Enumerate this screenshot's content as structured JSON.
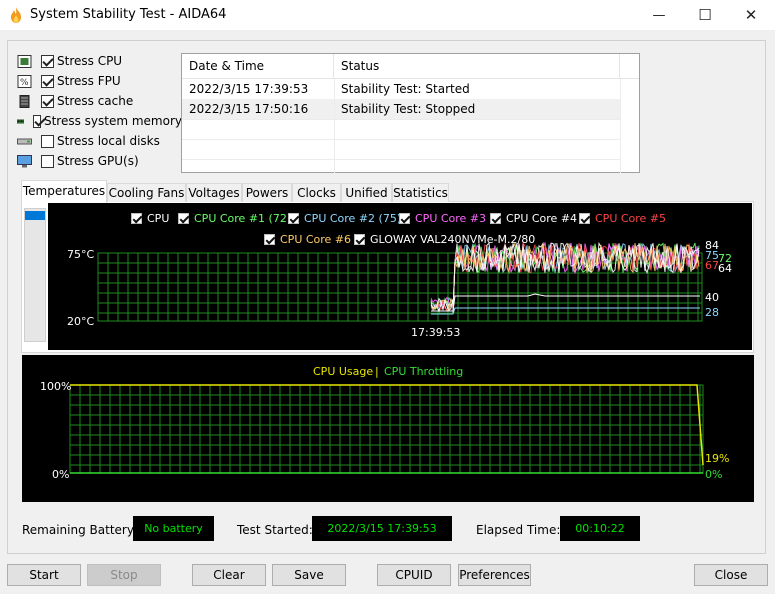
{
  "window": {
    "title": "System Stability Test - AIDA64",
    "min_glyph": "—",
    "max_glyph": "☐",
    "close_glyph": "✕"
  },
  "stress_options": [
    {
      "label": "Stress CPU",
      "checked": true,
      "icon": "cpu-icon"
    },
    {
      "label": "Stress FPU",
      "checked": true,
      "icon": "fpu-icon"
    },
    {
      "label": "Stress cache",
      "checked": true,
      "icon": "cache-icon"
    },
    {
      "label": "Stress system memory",
      "checked": true,
      "icon": "memory-icon"
    },
    {
      "label": "Stress local disks",
      "checked": false,
      "icon": "disk-icon"
    },
    {
      "label": "Stress GPU(s)",
      "checked": false,
      "icon": "gpu-icon"
    }
  ],
  "log": {
    "headers": [
      "Date & Time",
      "Status"
    ],
    "rows": [
      [
        "2022/3/15 17:39:53",
        "Stability Test: Started"
      ],
      [
        "2022/3/15 17:50:16",
        "Stability Test: Stopped"
      ]
    ]
  },
  "tabs": [
    "Temperatures",
    "Cooling Fans",
    "Voltages",
    "Powers",
    "Clocks",
    "Unified",
    "Statistics"
  ],
  "temperature_chart": {
    "legend": [
      {
        "label": "CPU",
        "color": "#ffffff"
      },
      {
        "label": "CPU Core #1 (72)",
        "color": "#66ff66"
      },
      {
        "label": "CPU Core #2 (75)",
        "color": "#8fd8ff"
      },
      {
        "label": "CPU Core #3",
        "color": "#ff66ff"
      },
      {
        "label": "CPU Core #4",
        "color": "#ffffff"
      },
      {
        "label": "CPU Core #5",
        "color": "#ff4444"
      },
      {
        "label": "CPU Core #6",
        "color": "#ffcc66"
      },
      {
        "label": "GLOWAY VAL240NVMe-M.2/80",
        "color": "#ffffff"
      }
    ],
    "y_max_label": "75°C",
    "y_min_label": "20°C",
    "x_label": "17:39:53",
    "right_values": [
      {
        "text": "84",
        "color": "#ffffff"
      },
      {
        "text": "75",
        "color": "#8fd8ff"
      },
      {
        "text": "72",
        "color": "#66ff66"
      },
      {
        "text": "67",
        "color": "#ff4444"
      },
      {
        "text": "64",
        "color": "#ffffff"
      },
      {
        "text": "40",
        "color": "#ffffff"
      },
      {
        "text": "28",
        "color": "#8fd8ff"
      }
    ]
  },
  "usage_chart": {
    "title_usage": "CPU Usage",
    "separator": "|",
    "title_throttle": "CPU Throttling",
    "usage_color": "#e8e800",
    "throttle_color": "#33dd33",
    "y_max_label": "100%",
    "y_min_label": "0%",
    "usage_value": "19%",
    "throttle_value": "0%"
  },
  "status": {
    "battery_label": "Remaining Battery:",
    "battery_value": "No battery",
    "started_label": "Test Started:",
    "started_value": "2022/3/15 17:39:53",
    "elapsed_label": "Elapsed Time:",
    "elapsed_value": "00:10:22"
  },
  "buttons": {
    "start": "Start",
    "stop": "Stop",
    "clear": "Clear",
    "save": "Save",
    "cpuid": "CPUID",
    "preferences": "Preferences",
    "close": "Close"
  }
}
